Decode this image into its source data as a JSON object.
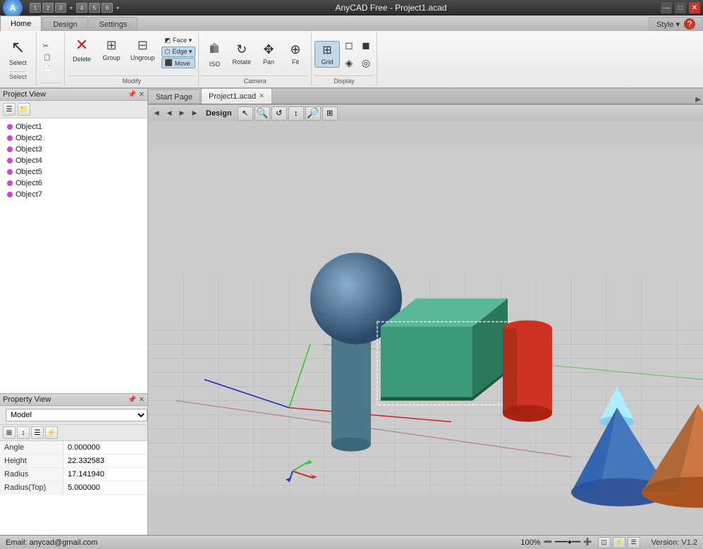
{
  "titlebar": {
    "title": "AnyCAD Free - Project1.acad",
    "app_icon_label": "A",
    "min_label": "—",
    "max_label": "□",
    "close_label": "✕",
    "style_label": "Style ▾",
    "help_label": "?"
  },
  "quickaccess": {
    "buttons": [
      "1",
      "2",
      "3",
      "▾",
      "4",
      "5",
      "6",
      "▾"
    ]
  },
  "ribbon": {
    "tabs": [
      {
        "id": "home",
        "label": "Home",
        "active": true
      },
      {
        "id": "design",
        "label": "Design",
        "active": false
      },
      {
        "id": "settings",
        "label": "Settings",
        "active": false
      }
    ],
    "groups": {
      "select": {
        "label": "Select",
        "icon": "↖",
        "btn_label": "Select"
      },
      "clipboard": {
        "buttons": [
          {
            "icon": "✂",
            "label": ""
          },
          {
            "icon": "📋",
            "label": ""
          },
          {
            "icon": "📄",
            "label": ""
          }
        ]
      },
      "modify": {
        "label": "Modify",
        "buttons": [
          {
            "icon": "✕",
            "label": "Delete"
          },
          {
            "icon": "⊞",
            "label": "Group"
          },
          {
            "icon": "⊟",
            "label": "Ungroup"
          }
        ],
        "small_buttons": [
          {
            "icon": "◩",
            "label": "Face ▾"
          },
          {
            "icon": "⬡",
            "label": "Edge ▾"
          },
          {
            "icon": "⬛",
            "label": "Move"
          }
        ]
      },
      "camera": {
        "label": "Camera",
        "buttons": [
          {
            "icon": "📷",
            "label": "ISO"
          },
          {
            "icon": "↻",
            "label": "Rotate"
          },
          {
            "icon": "✥",
            "label": "Pan"
          },
          {
            "icon": "⊕",
            "label": "Fit"
          }
        ]
      },
      "grid": {
        "label": "Display",
        "grid_active": true,
        "buttons": [
          {
            "icon": "⊞",
            "label": "Grid"
          },
          {
            "icon": "◻",
            "label": ""
          },
          {
            "icon": "◼",
            "label": ""
          },
          {
            "icon": "◈",
            "label": ""
          },
          {
            "icon": "◎",
            "label": ""
          },
          {
            "icon": "⬡",
            "label": ""
          }
        ]
      }
    }
  },
  "project_view": {
    "title": "Project View",
    "objects": [
      {
        "label": "Object1"
      },
      {
        "label": "Object2"
      },
      {
        "label": "Object3"
      },
      {
        "label": "Object4"
      },
      {
        "label": "Object5"
      },
      {
        "label": "Object6"
      },
      {
        "label": "Object7"
      }
    ]
  },
  "property_view": {
    "title": "Property View",
    "model_select": "Model",
    "properties": [
      {
        "name": "Angle",
        "value": "0.000000"
      },
      {
        "name": "Height",
        "value": "22.332583"
      },
      {
        "name": "Radius",
        "value": "17.141940"
      },
      {
        "name": "Radius(Top)",
        "value": "5.000000"
      }
    ]
  },
  "tabs": {
    "items": [
      {
        "label": "Start Page",
        "active": false,
        "closeable": false
      },
      {
        "label": "Project1.acad",
        "active": true,
        "closeable": true
      }
    ],
    "scroll_right": "▶"
  },
  "viewport": {
    "design_label": "Design"
  },
  "statusbar": {
    "email": "Email: anycad@gmail.com",
    "zoom": "100%",
    "version": "Version: V1.2"
  }
}
